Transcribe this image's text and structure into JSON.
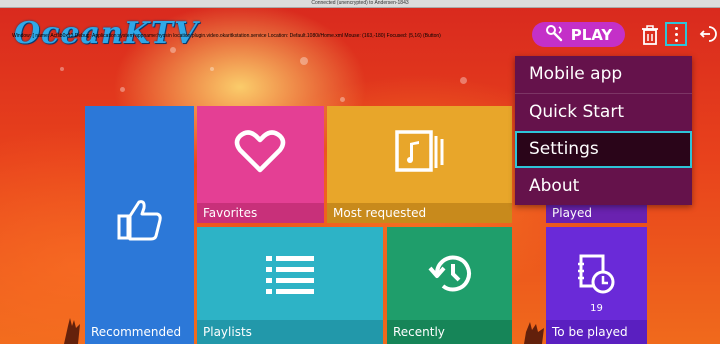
{
  "window": {
    "title": "Connected (unencrypted) to Andersen-1843"
  },
  "debug_text": "Window: [ name: Actlib0x13  Debug: Application:system  appname:hyosin  location:plugin.video.okaritkstation.service  Location: Default.1080i/Home.xml  Mouse: (163,-180)  Focused: (5,16)  (Button)",
  "app": {
    "logo": "OceanKTV"
  },
  "header": {
    "play_label": "PLAY"
  },
  "icons": {
    "play": "microphone-icon",
    "trash": "trash-icon",
    "more": "more-vertical-icon",
    "exit": "exit-icon"
  },
  "tiles": {
    "recommended": {
      "label": "Recommended",
      "color": "#2c78d8"
    },
    "favorites": {
      "label": "Favorites",
      "color": "#e43f94"
    },
    "most_requested": {
      "label": "Most requested",
      "color": "#e8a62a"
    },
    "played": {
      "label": "Played",
      "color": "#7a2ec4"
    },
    "playlists": {
      "label": "Playlists",
      "color": "#2db3c6"
    },
    "recently_requested": {
      "label": "Recently requested",
      "color": "#1f9e6b"
    },
    "to_be_played": {
      "label": "To be played",
      "count": "19",
      "color": "#6a2ad8"
    }
  },
  "menu": {
    "items": [
      {
        "label": "Mobile app"
      },
      {
        "label": "Quick Start"
      },
      {
        "label": "Settings",
        "selected": true
      },
      {
        "label": "About"
      }
    ]
  },
  "colors": {
    "accent": "#2ec4d8",
    "play_button": "#c430c8",
    "menu_bg": "#65124b"
  }
}
